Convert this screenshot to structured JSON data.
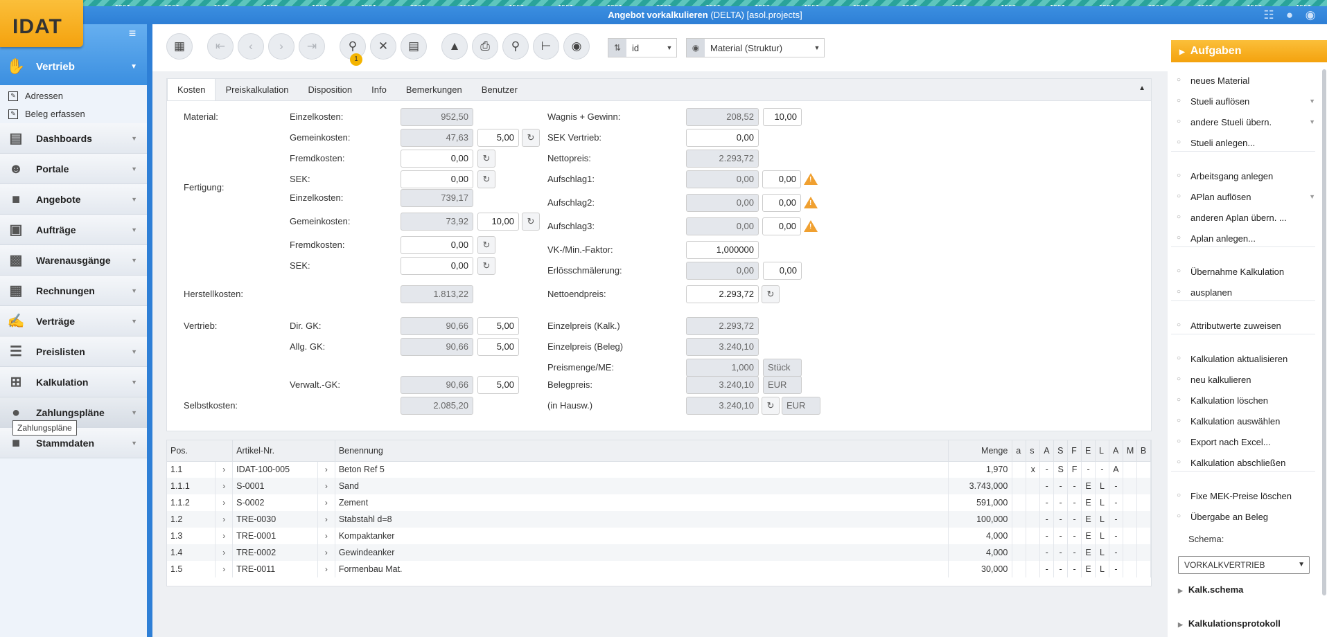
{
  "banner": {
    "text": "TEST"
  },
  "window": {
    "title_bold": "Angebot vorkalkulieren",
    "title_rest": " (DELTA) [asol.projects]"
  },
  "logo": {
    "text": "IDAT"
  },
  "sidebar": {
    "active": {
      "label": "Vertrieb",
      "icon": "handshake-icon"
    },
    "subitems": [
      {
        "label": "Adressen"
      },
      {
        "label": "Beleg erfassen"
      }
    ],
    "items": [
      {
        "label": "Dashboards",
        "icon": "dashboard-icon"
      },
      {
        "label": "Portale",
        "icon": "people-icon"
      },
      {
        "label": "Angebote",
        "icon": "offer-icon"
      },
      {
        "label": "Aufträge",
        "icon": "clipboard-icon"
      },
      {
        "label": "Warenausgänge",
        "icon": "box-icon"
      },
      {
        "label": "Rechnungen",
        "icon": "invoice-icon"
      },
      {
        "label": "Verträge",
        "icon": "contract-icon"
      },
      {
        "label": "Preislisten",
        "icon": "list-icon"
      },
      {
        "label": "Kalkulation",
        "icon": "calculator-icon"
      },
      {
        "label": "Zahlungspläne",
        "icon": "payment-icon"
      },
      {
        "label": "Stammdaten",
        "icon": "master-data-icon"
      }
    ],
    "tooltip": "Zahlungspläne"
  },
  "toolbar": {
    "search_badge": "1",
    "sort_select": {
      "value": "id",
      "icon": "sort-icon"
    },
    "view_select": {
      "value": "Material (Struktur)",
      "icon": "eye-icon"
    }
  },
  "tabs": [
    "Kosten",
    "Preiskalkulation",
    "Disposition",
    "Info",
    "Bemerkungen",
    "Benutzer"
  ],
  "form": {
    "material": "Material:",
    "fertigung": "Fertigung:",
    "herstellkosten": "Herstellkosten:",
    "vertrieb": "Vertrieb:",
    "selbstkosten": "Selbstkosten:",
    "einzelkosten": "Einzelkosten:",
    "gemeinkosten": "Gemeinkosten:",
    "fremdkosten": "Fremdkosten:",
    "sek": "SEK:",
    "dir_gk": "Dir. GK:",
    "allg_gk": "Allg. GK:",
    "verwalt_gk": "Verwalt.-GK:",
    "mat_einzel": "952,50",
    "mat_gemein": "47,63",
    "mat_gemein_pct": "5,00",
    "mat_fremd": "0,00",
    "mat_sek": "0,00",
    "fert_einzel": "739,17",
    "fert_gemein": "73,92",
    "fert_gemein_pct": "10,00",
    "fert_fremd": "0,00",
    "fert_sek": "0,00",
    "herstell": "1.813,22",
    "dir_gk_val": "90,66",
    "dir_gk_pct": "5,00",
    "allg_gk_val": "90,66",
    "allg_gk_pct": "5,00",
    "verwalt_gk_val": "90,66",
    "verwalt_gk_pct": "5,00",
    "selbst": "2.085,20",
    "wagnis_lbl": "Wagnis + Gewinn:",
    "wagnis_val": "208,52",
    "wagnis_pct": "10,00",
    "sek_vertrieb_lbl": "SEK Vertrieb:",
    "sek_vertrieb_val": "0,00",
    "netto_lbl": "Nettopreis:",
    "netto_val": "2.293,72",
    "aufschlag1_lbl": "Aufschlag1:",
    "aufschlag1_val": "0,00",
    "aufschlag1_pct": "0,00",
    "aufschlag2_lbl": "Aufschlag2:",
    "aufschlag2_val": "0,00",
    "aufschlag2_pct": "0,00",
    "aufschlag3_lbl": "Aufschlag3:",
    "aufschlag3_val": "0,00",
    "aufschlag3_pct": "0,00",
    "vk_faktor_lbl": "VK-/Min.-Faktor:",
    "vk_faktor_val": "1,000000",
    "erloes_lbl": "Erlösschmälerung:",
    "erloes_val": "0,00",
    "erloes_pct": "0,00",
    "nettoend_lbl": "Nettoendpreis:",
    "nettoend_val": "2.293,72",
    "einzelpreis_kalk_lbl": "Einzelpreis (Kalk.)",
    "einzelpreis_kalk_val": "2.293,72",
    "einzelpreis_beleg_lbl": "Einzelpreis (Beleg)",
    "einzelpreis_beleg_val": "3.240,10",
    "preismenge_lbl": "Preismenge/ME:",
    "preismenge_val": "1,000",
    "preismenge_unit": "Stück",
    "belegpreis_lbl": "Belegpreis:",
    "belegpreis_val": "3.240,10",
    "belegpreis_cur": "EUR",
    "hausw_lbl": "(in Hausw.)",
    "hausw_val": "3.240,10",
    "hausw_cur": "EUR"
  },
  "table": {
    "columns": [
      "Pos.",
      "Artikel-Nr.",
      "Benennung",
      "Menge",
      "a",
      "s",
      "A",
      "S",
      "F",
      "E",
      "L",
      "A",
      "M",
      "B"
    ],
    "rows": [
      {
        "pos": "1.1",
        "artikel": "IDAT-100-005",
        "benennung": "Beton Ref 5",
        "menge": "1,970",
        "flags": [
          "",
          "x",
          "-",
          "S",
          "F",
          "-",
          "-",
          "A",
          "",
          ""
        ]
      },
      {
        "pos": "1.1.1",
        "artikel": "S-0001",
        "benennung": "Sand",
        "menge": "3.743,000",
        "flags": [
          "",
          "",
          "-",
          "-",
          "-",
          "E",
          "L",
          "-",
          "",
          ""
        ]
      },
      {
        "pos": "1.1.2",
        "artikel": "S-0002",
        "benennung": "Zement",
        "menge": "591,000",
        "flags": [
          "",
          "",
          "-",
          "-",
          "-",
          "E",
          "L",
          "-",
          "",
          ""
        ]
      },
      {
        "pos": "1.2",
        "artikel": "TRE-0030",
        "benennung": "Stabstahl d=8",
        "menge": "100,000",
        "flags": [
          "",
          "",
          "-",
          "-",
          "-",
          "E",
          "L",
          "-",
          "",
          ""
        ]
      },
      {
        "pos": "1.3",
        "artikel": "TRE-0001",
        "benennung": "Kompaktanker",
        "menge": "4,000",
        "flags": [
          "",
          "",
          "-",
          "-",
          "-",
          "E",
          "L",
          "-",
          "",
          ""
        ]
      },
      {
        "pos": "1.4",
        "artikel": "TRE-0002",
        "benennung": "Gewindeanker",
        "menge": "4,000",
        "flags": [
          "",
          "",
          "-",
          "-",
          "-",
          "E",
          "L",
          "-",
          "",
          ""
        ]
      },
      {
        "pos": "1.5",
        "artikel": "TRE-0011",
        "benennung": "Formenbau Mat.",
        "menge": "30,000",
        "flags": [
          "",
          "",
          "-",
          "-",
          "-",
          "E",
          "L",
          "-",
          "",
          ""
        ]
      }
    ]
  },
  "tasks": {
    "title": "Aufgaben",
    "items": [
      {
        "label": "neues Material",
        "dropdown": false
      },
      {
        "label": "Stueli auflösen",
        "dropdown": true
      },
      {
        "label": "andere Stueli übern.",
        "dropdown": true
      },
      {
        "label": "Stueli anlegen...",
        "dropdown": false
      },
      {
        "label": "Arbeitsgang anlegen",
        "dropdown": false
      },
      {
        "label": "APlan auflösen",
        "dropdown": true
      },
      {
        "label": "anderen Aplan übern. ...",
        "dropdown": false
      },
      {
        "label": "Aplan anlegen...",
        "dropdown": false
      },
      {
        "label": "Übernahme Kalkulation",
        "dropdown": false
      },
      {
        "label": "ausplanen",
        "dropdown": false
      },
      {
        "label": "Attributwerte zuweisen",
        "dropdown": false
      },
      {
        "label": "Kalkulation aktualisieren",
        "dropdown": false
      },
      {
        "label": "neu kalkulieren",
        "dropdown": false
      },
      {
        "label": "Kalkulation löschen",
        "dropdown": false
      },
      {
        "label": "Kalkulation auswählen",
        "dropdown": false
      },
      {
        "label": "Export nach Excel...",
        "dropdown": false
      },
      {
        "label": "Kalkulation abschließen",
        "dropdown": false
      },
      {
        "label": "Fixe MEK-Preise löschen",
        "dropdown": false
      },
      {
        "label": "Übergabe an Beleg",
        "dropdown": false
      }
    ],
    "schema_label": "Schema:",
    "schema_value": "VORKALKVERTRIEB",
    "kalk_schema": "Kalk.schema",
    "kalk_protokoll": "Kalkulationsprotokoll"
  },
  "colors": {
    "accent": "#2e7fd6",
    "brand": "#f4a20e",
    "warning": "#f0a030",
    "banner": "#2aa39a"
  }
}
